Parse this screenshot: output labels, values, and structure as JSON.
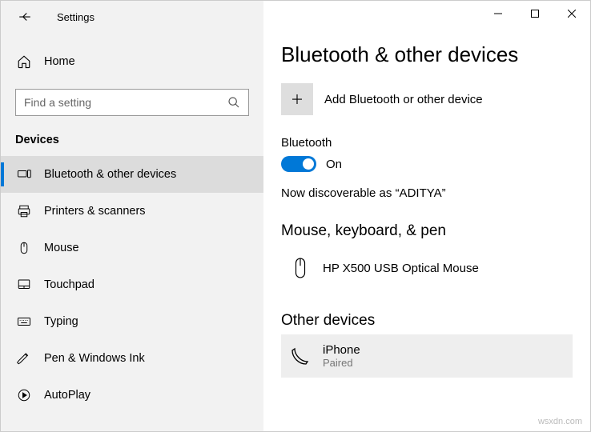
{
  "titlebar": {
    "app_title": "Settings"
  },
  "home": {
    "label": "Home"
  },
  "search": {
    "placeholder": "Find a setting"
  },
  "section_title": "Devices",
  "nav": [
    {
      "label": "Bluetooth & other devices"
    },
    {
      "label": "Printers & scanners"
    },
    {
      "label": "Mouse"
    },
    {
      "label": "Touchpad"
    },
    {
      "label": "Typing"
    },
    {
      "label": "Pen & Windows Ink"
    },
    {
      "label": "AutoPlay"
    }
  ],
  "page": {
    "title": "Bluetooth & other devices",
    "add_label": "Add Bluetooth or other device",
    "bt_label": "Bluetooth",
    "toggle_state": "On",
    "discoverable": "Now discoverable as “ADITYA”",
    "mouse_heading": "Mouse, keyboard, & pen",
    "mouse_device": {
      "name": "HP X500 USB Optical Mouse"
    },
    "other_heading": "Other devices",
    "other_device": {
      "name": "iPhone",
      "status": "Paired"
    }
  },
  "watermark": "wsxdn.com"
}
